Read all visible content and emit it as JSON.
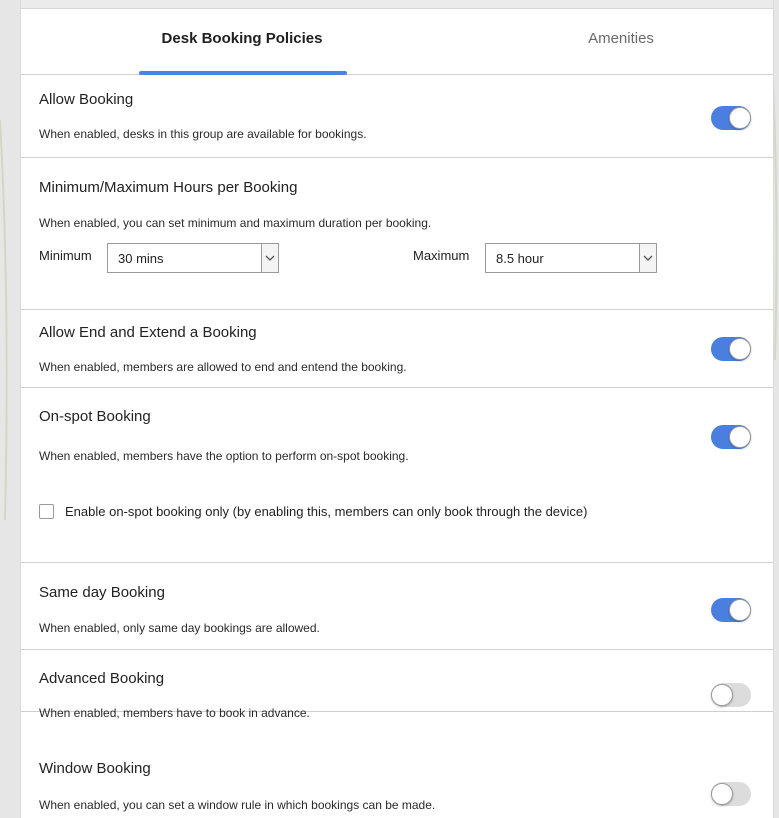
{
  "tabs": [
    {
      "label": "Desk Booking Policies",
      "active": true
    },
    {
      "label": "Amenities",
      "active": false
    }
  ],
  "accent_color": "#4b82e3",
  "toggle_off_color": "#dcdcdc",
  "sections": {
    "allow_booking": {
      "title": "Allow Booking",
      "desc": "When enabled, desks in this group are available for bookings.",
      "enabled": true
    },
    "min_max_hours": {
      "title": "Minimum/Maximum Hours per Booking",
      "desc": "When enabled, you can set minimum and maximum duration per booking.",
      "min_label": "Minimum",
      "min_value": "30 mins",
      "max_label": "Maximum",
      "max_value": "8.5 hour"
    },
    "end_extend": {
      "title": "Allow End and Extend a Booking",
      "desc": "When enabled, members are allowed to end and entend the booking.",
      "enabled": true
    },
    "on_spot": {
      "title": "On-spot Booking",
      "desc": "When enabled, members have the option to perform on-spot booking.",
      "enabled": true,
      "checkbox_label": "Enable on-spot booking only (by enabling this, members can only book through the device)",
      "checkbox_checked": false
    },
    "same_day": {
      "title": "Same day Booking",
      "desc": "When enabled, only same day bookings are allowed.",
      "enabled": true
    },
    "advanced": {
      "title": "Advanced Booking",
      "desc": "When enabled, members have to book in advance.",
      "enabled": false
    },
    "window": {
      "title": "Window Booking",
      "desc": "When enabled, you can set a window rule in which bookings can be made.",
      "enabled": false
    }
  }
}
